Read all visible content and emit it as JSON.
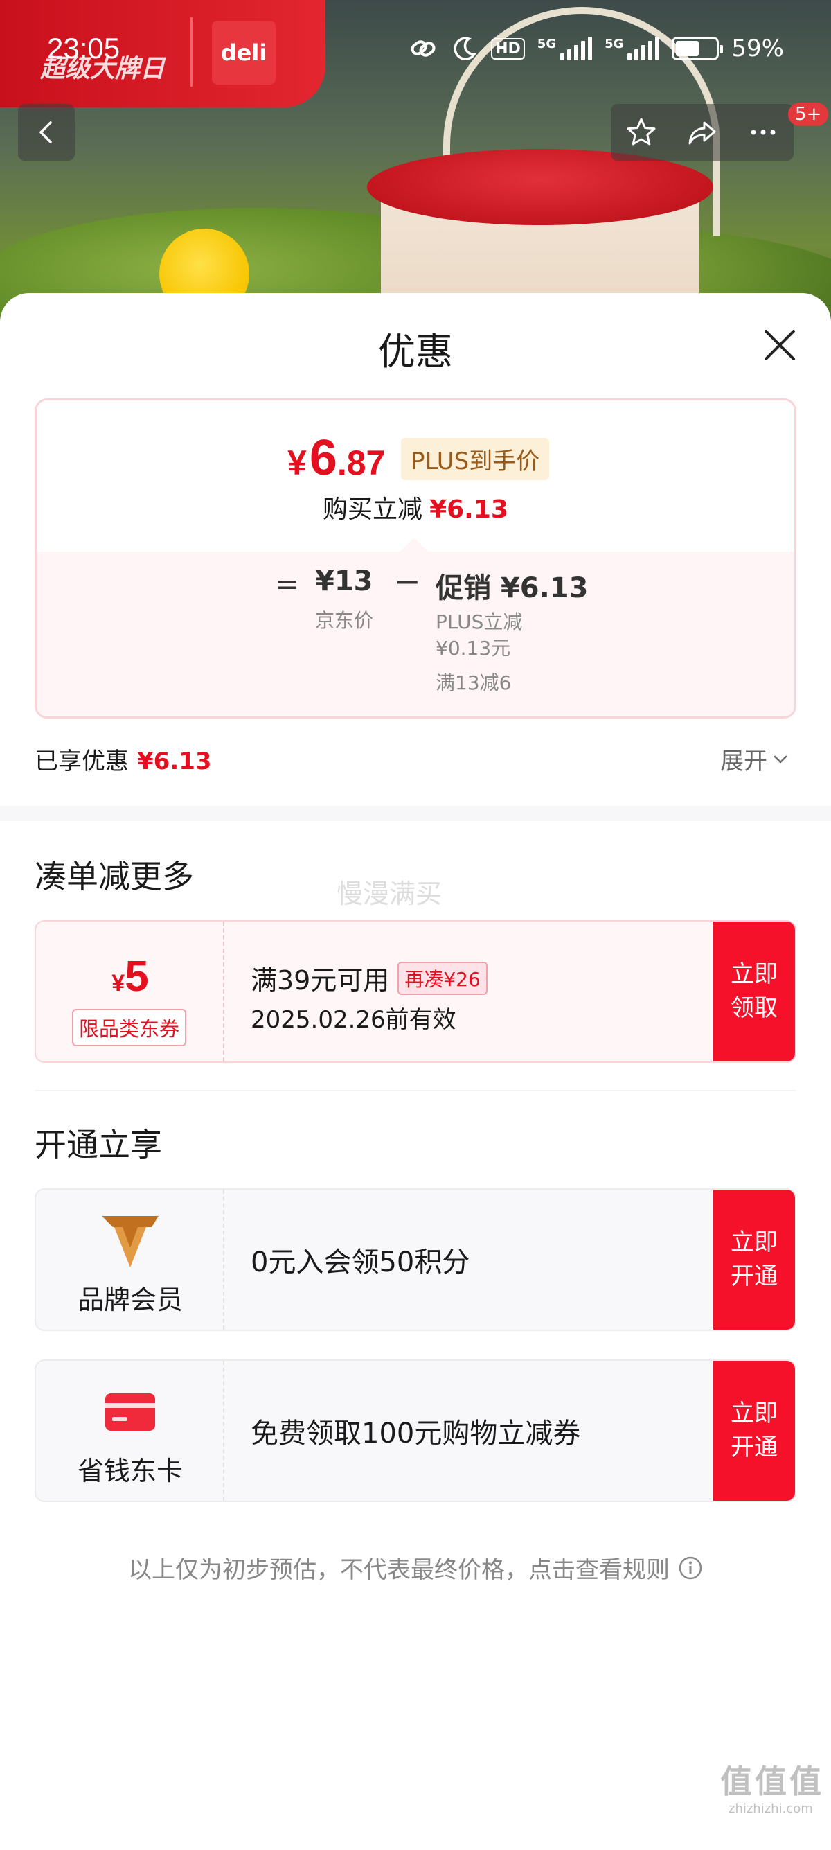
{
  "status_bar": {
    "time": "23:05",
    "hd_label": "HD",
    "net1": "5G",
    "net2": "5G",
    "battery_percent": "59%",
    "battery_level": 0.59
  },
  "header_banner": {
    "banner_text": "超级大牌日",
    "brand": "deli"
  },
  "nav": {
    "notification_badge": "5+"
  },
  "sheet": {
    "title": "优惠",
    "price_card": {
      "currency": "¥",
      "final_int": "6",
      "final_dec": ".87",
      "plus_tag": "PLUS到手价",
      "reduce_label": "购买立减",
      "reduce_amount": "¥6.13",
      "equals": "=",
      "jd_price": "¥13",
      "jd_label": "京东价",
      "minus": "−",
      "promo_price": "促销 ¥6.13",
      "promo_detail_1": "PLUS立减",
      "promo_detail_2": "¥0.13元",
      "promo_detail_3": "满13减6"
    },
    "enjoyed_label": "已享优惠",
    "enjoyed_amount": "¥6.13",
    "expand_label": "展开",
    "section_combine": "凑单减更多",
    "watermark": "慢漫满买",
    "coupon": {
      "currency": "¥",
      "amount": "5",
      "tag": "限品类东券",
      "condition": "满39元可用",
      "more_tag": "再凑¥26",
      "valid": "2025.02.26前有效",
      "button": "立即\n领取"
    },
    "section_open": "开通立享",
    "memberships": [
      {
        "label": "品牌会员",
        "desc": "0元入会领50积分",
        "button": "立即\n开通",
        "icon": "brand-v-icon"
      },
      {
        "label": "省钱东卡",
        "desc": "免费领取100元购物立减券",
        "button": "立即\n开通",
        "icon": "red-card-icon"
      }
    ],
    "footnote": "以上仅为初步预估，不代表最终价格，点击查看规则"
  },
  "site_watermark": {
    "mark": "值值值",
    "domain": "zhizhizhi.com"
  },
  "colors": {
    "accent_red": "#e4101f",
    "button_red": "#f5112a",
    "plus_gold_bg": "#fdf0d8"
  }
}
